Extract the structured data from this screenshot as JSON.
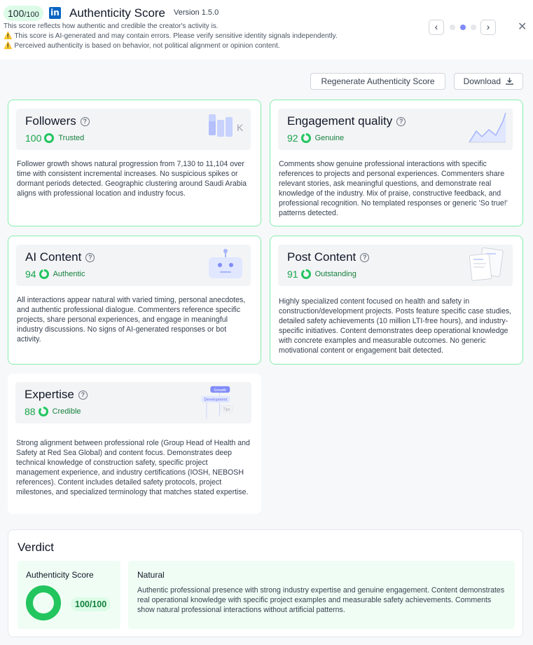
{
  "header": {
    "score_main": "100",
    "score_suffix": "/100",
    "logo_letters": "in",
    "title": "Authenticity Score",
    "version": "Version 1.5.0",
    "line1": "This score reflects how authentic and credible the creator's activity is.",
    "line2": "This score is AI-generated and may contain errors. Please verify sensitive identity signals independently.",
    "line3": "Perceived authenticity is based on behavior, not political alignment or opinion content.",
    "warn_glyph": "⚠️",
    "prev_glyph": "‹",
    "next_glyph": "›",
    "close_glyph": "✕",
    "page_dots": 3,
    "active_dot": 2
  },
  "actions": {
    "regenerate": "Regenerate Authenticity Score",
    "download": "Download"
  },
  "cards": {
    "followers": {
      "title": "Followers",
      "score": "100",
      "score_value": 100,
      "label": "Trusted",
      "art_letter": "K",
      "body": "Follower growth shows natural progression from 7,130 to 11,104 over time with consistent incremental increases. No suspicious spikes or dormant periods detected. Geographic clustering around Saudi Arabia aligns with professional location and industry focus."
    },
    "engagement": {
      "title": "Engagement quality",
      "score": "92",
      "score_value": 92,
      "label": "Genuine",
      "body": "Comments show genuine professional interactions with specific references to projects and personal experiences. Commenters share relevant stories, ask meaningful questions, and demonstrate real knowledge of the industry. Mix of praise, constructive feedback, and professional recognition. No templated responses or generic 'So true!' patterns detected."
    },
    "ai": {
      "title": "AI Content",
      "score": "94",
      "score_value": 94,
      "label": "Authentic",
      "body": "All interactions appear natural with varied timing, personal anecdotes, and authentic professional dialogue. Commenters reference specific projects, share personal experiences, and engage in meaningful industry discussions. No signs of AI-generated responses or bot activity."
    },
    "post": {
      "title": "Post Content",
      "score": "91",
      "score_value": 91,
      "label": "Outstanding",
      "body": "Highly specialized content focused on health and safety in construction/development projects. Posts feature specific case studies, detailed safety achievements (10 million LTI-free hours), and industry-specific initiatives. Content demonstrates deep operational knowledge with concrete examples and measurable outcomes. No generic motivational content or engagement bait detected."
    },
    "expertise": {
      "title": "Expertise",
      "score": "88",
      "score_value": 88,
      "label": "Credible",
      "art_growth": "Growth",
      "art_development": "Development",
      "art_tips": "Tips",
      "body": "Strong alignment between professional role (Group Head of Health and Safety at Red Sea Global) and content focus. Demonstrates deep technical knowledge of construction safety, specific project management experience, and industry certifications (IOSH, NEBOSH references). Content includes detailed safety protocols, project milestones, and specialized terminology that matches stated expertise."
    }
  },
  "verdict": {
    "title": "Verdict",
    "score_label": "Authenticity Score",
    "score_text": "100/100",
    "score_value": 100,
    "category": "Natural",
    "text": "Authentic professional presence with strong industry expertise and genuine engagement. Content demonstrates real operational knowledge with specific project examples and measurable safety achievements. Comments show natural professional interactions without artificial patterns."
  },
  "colors": {
    "accent_green": "#22c55e",
    "track_green": "#dcfce7",
    "border_green": "#86efac",
    "dot_active": "#818cf8"
  }
}
